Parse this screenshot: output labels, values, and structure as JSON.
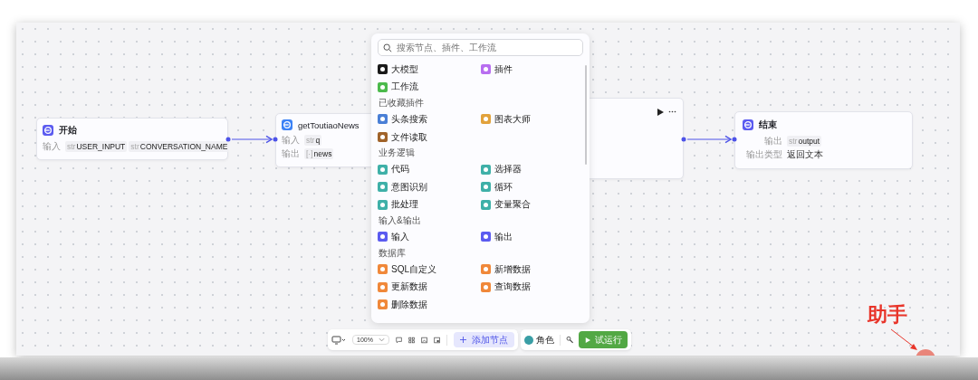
{
  "nodes": {
    "start": {
      "title": "开始",
      "rows": [
        {
          "label": "输入",
          "params": [
            {
              "type": "str",
              "name": "USER_INPUT"
            },
            {
              "type": "str",
              "name": "CONVERSATION_NAME"
            }
          ]
        }
      ]
    },
    "plugin": {
      "title": "getToutiaoNews",
      "rows": [
        {
          "label": "输入",
          "params": [
            {
              "type": "str",
              "name": "q"
            }
          ]
        },
        {
          "label": "输出",
          "params": [
            {
              "type": "[·]",
              "name": "news"
            }
          ]
        }
      ]
    },
    "end": {
      "title": "结束",
      "rows": [
        {
          "label": "输出",
          "params": [
            {
              "type": "str",
              "name": "output"
            }
          ]
        },
        {
          "label": "输出类型",
          "value": "返回文本"
        }
      ]
    }
  },
  "menu": {
    "search_placeholder": "搜索节点、插件、工作流",
    "sections": [
      {
        "items": [
          {
            "label": "大模型",
            "color": "#1a1a1a"
          },
          {
            "label": "插件",
            "color": "#b86ef0"
          },
          {
            "label": "工作流",
            "color": "#4cba4c"
          }
        ]
      },
      {
        "title": "已收藏插件",
        "items": [
          {
            "label": "头条搜索",
            "color": "#4a7fd6"
          },
          {
            "label": "图表大师",
            "color": "#e2a23c"
          },
          {
            "label": "文件读取",
            "color": "#a0632a"
          }
        ]
      },
      {
        "title": "业务逻辑",
        "items": [
          {
            "label": "代码",
            "color": "#3fb0a8"
          },
          {
            "label": "选择器",
            "color": "#3fb0a8"
          },
          {
            "label": "意图识别",
            "color": "#3fb0a8"
          },
          {
            "label": "循环",
            "color": "#3fb0a8"
          },
          {
            "label": "批处理",
            "color": "#3fb0a8"
          },
          {
            "label": "变量聚合",
            "color": "#3fb0a8"
          }
        ]
      },
      {
        "title": "输入&输出",
        "items": [
          {
            "label": "输入",
            "color": "#5b5bf0"
          },
          {
            "label": "输出",
            "color": "#5b5bf0"
          }
        ]
      },
      {
        "title": "数据库",
        "items": [
          {
            "label": "SQL自定义",
            "color": "#f0883a"
          },
          {
            "label": "新增数据",
            "color": "#f0883a"
          },
          {
            "label": "更新数据",
            "color": "#f0883a"
          },
          {
            "label": "查询数据",
            "color": "#f0883a"
          },
          {
            "label": "删除数据",
            "color": "#f0883a"
          }
        ]
      }
    ]
  },
  "toolbar": {
    "zoom": "100%",
    "add_node": "添加节点",
    "role": "角色",
    "run": "试运行"
  },
  "annotation": {
    "text": "助手"
  }
}
